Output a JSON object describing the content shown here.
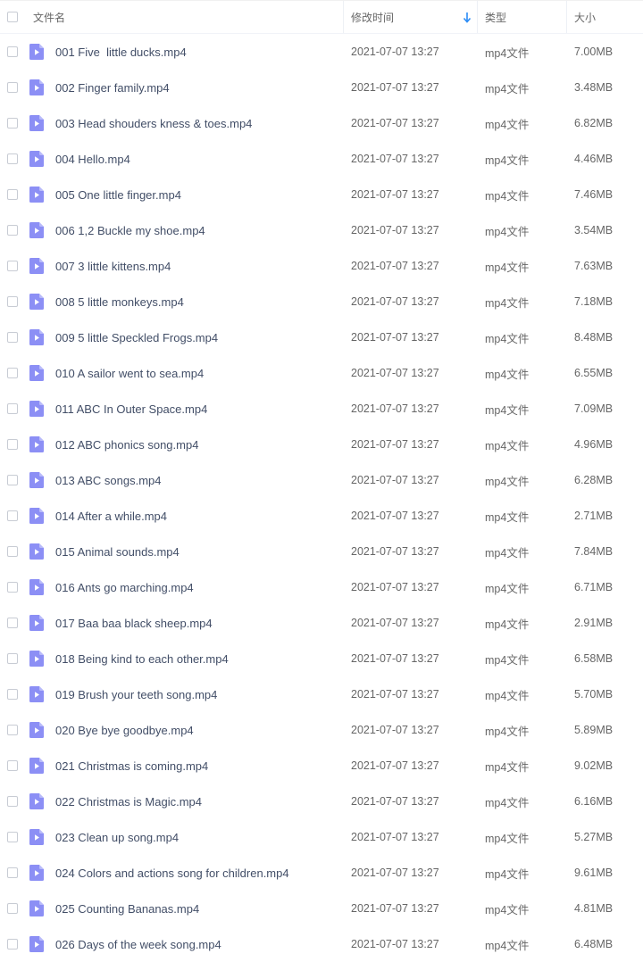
{
  "header": {
    "name": "文件名",
    "modified": "修改时间",
    "type": "类型",
    "size": "大小"
  },
  "rows": [
    {
      "name": "001 Five  little ducks.mp4",
      "modified": "2021-07-07 13:27",
      "type": "mp4文件",
      "size": "7.00MB"
    },
    {
      "name": "002 Finger family.mp4",
      "modified": "2021-07-07 13:27",
      "type": "mp4文件",
      "size": "3.48MB"
    },
    {
      "name": "003 Head shouders kness & toes.mp4",
      "modified": "2021-07-07 13:27",
      "type": "mp4文件",
      "size": "6.82MB"
    },
    {
      "name": "004 Hello.mp4",
      "modified": "2021-07-07 13:27",
      "type": "mp4文件",
      "size": "4.46MB"
    },
    {
      "name": "005 One little finger.mp4",
      "modified": "2021-07-07 13:27",
      "type": "mp4文件",
      "size": "7.46MB"
    },
    {
      "name": "006 1,2 Buckle my shoe.mp4",
      "modified": "2021-07-07 13:27",
      "type": "mp4文件",
      "size": "3.54MB"
    },
    {
      "name": "007 3 little kittens.mp4",
      "modified": "2021-07-07 13:27",
      "type": "mp4文件",
      "size": "7.63MB"
    },
    {
      "name": "008 5 little monkeys.mp4",
      "modified": "2021-07-07 13:27",
      "type": "mp4文件",
      "size": "7.18MB"
    },
    {
      "name": "009 5 little Speckled Frogs.mp4",
      "modified": "2021-07-07 13:27",
      "type": "mp4文件",
      "size": "8.48MB"
    },
    {
      "name": "010 A sailor went to sea.mp4",
      "modified": "2021-07-07 13:27",
      "type": "mp4文件",
      "size": "6.55MB"
    },
    {
      "name": "011 ABC In Outer Space.mp4",
      "modified": "2021-07-07 13:27",
      "type": "mp4文件",
      "size": "7.09MB"
    },
    {
      "name": "012 ABC phonics song.mp4",
      "modified": "2021-07-07 13:27",
      "type": "mp4文件",
      "size": "4.96MB"
    },
    {
      "name": "013 ABC songs.mp4",
      "modified": "2021-07-07 13:27",
      "type": "mp4文件",
      "size": "6.28MB"
    },
    {
      "name": "014 After a while.mp4",
      "modified": "2021-07-07 13:27",
      "type": "mp4文件",
      "size": "2.71MB"
    },
    {
      "name": "015 Animal sounds.mp4",
      "modified": "2021-07-07 13:27",
      "type": "mp4文件",
      "size": "7.84MB"
    },
    {
      "name": "016 Ants go marching.mp4",
      "modified": "2021-07-07 13:27",
      "type": "mp4文件",
      "size": "6.71MB"
    },
    {
      "name": "017 Baa baa black sheep.mp4",
      "modified": "2021-07-07 13:27",
      "type": "mp4文件",
      "size": "2.91MB"
    },
    {
      "name": "018 Being kind to each other.mp4",
      "modified": "2021-07-07 13:27",
      "type": "mp4文件",
      "size": "6.58MB"
    },
    {
      "name": "019 Brush your teeth song.mp4",
      "modified": "2021-07-07 13:27",
      "type": "mp4文件",
      "size": "5.70MB"
    },
    {
      "name": "020 Bye bye goodbye.mp4",
      "modified": "2021-07-07 13:27",
      "type": "mp4文件",
      "size": "5.89MB"
    },
    {
      "name": "021 Christmas is coming.mp4",
      "modified": "2021-07-07 13:27",
      "type": "mp4文件",
      "size": "9.02MB"
    },
    {
      "name": "022 Christmas is Magic.mp4",
      "modified": "2021-07-07 13:27",
      "type": "mp4文件",
      "size": "6.16MB"
    },
    {
      "name": "023 Clean up song.mp4",
      "modified": "2021-07-07 13:27",
      "type": "mp4文件",
      "size": "5.27MB"
    },
    {
      "name": "024 Colors and actions song for children.mp4",
      "modified": "2021-07-07 13:27",
      "type": "mp4文件",
      "size": "9.61MB"
    },
    {
      "name": "025 Counting Bananas.mp4",
      "modified": "2021-07-07 13:27",
      "type": "mp4文件",
      "size": "4.81MB"
    },
    {
      "name": "026 Days of the week song.mp4",
      "modified": "2021-07-07 13:27",
      "type": "mp4文件",
      "size": "6.48MB"
    }
  ],
  "icons": {
    "file": "video-file-icon",
    "sort": "sort-descending-arrow-icon"
  },
  "colors": {
    "file_icon": "#8c8ff5",
    "file_icon_fold": "#b9bbfa",
    "sort_arrow": "#2b8cf6"
  }
}
